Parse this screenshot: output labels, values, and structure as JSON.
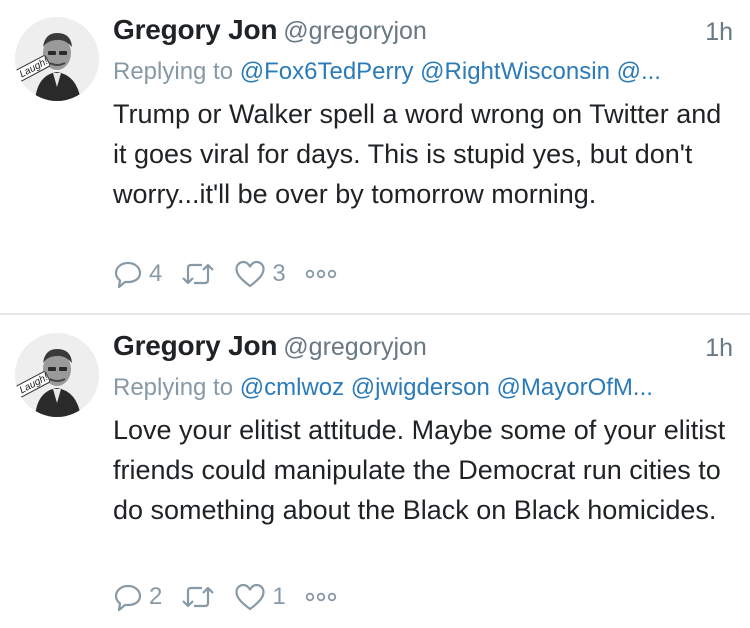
{
  "tweets": [
    {
      "author_name": "Gregory Jon",
      "author_handle": "@gregoryjon",
      "time": "1h",
      "replying_prefix": "Replying to",
      "replying_mentions": "@Fox6TedPerry @RightWisconsin @...",
      "text": "Trump or Walker spell a word wrong on Twitter and it goes viral for days. This is stupid yes, but don't worry...it'll be over by tomorrow morning.",
      "reply_count": "4",
      "like_count": "3",
      "avatar_badge_text": "Laugh!"
    },
    {
      "author_name": "Gregory Jon",
      "author_handle": "@gregoryjon",
      "time": "1h",
      "replying_prefix": "Replying to",
      "replying_mentions": "@cmlwoz @jwigderson @MayorOfM...",
      "text": "Love your elitist attitude.  Maybe some of your elitist friends could manipulate the Democrat run cities to do something about the Black on Black homicides.",
      "reply_count": "2",
      "like_count": "1",
      "avatar_badge_text": "Laugh!"
    }
  ],
  "icons": [
    "reply-icon",
    "retweet-icon",
    "like-icon",
    "more-icon"
  ],
  "colors": {
    "text": "#1f2326",
    "muted": "#8899a6",
    "mention": "#2b7bb9",
    "divider": "#e3e6e8"
  }
}
